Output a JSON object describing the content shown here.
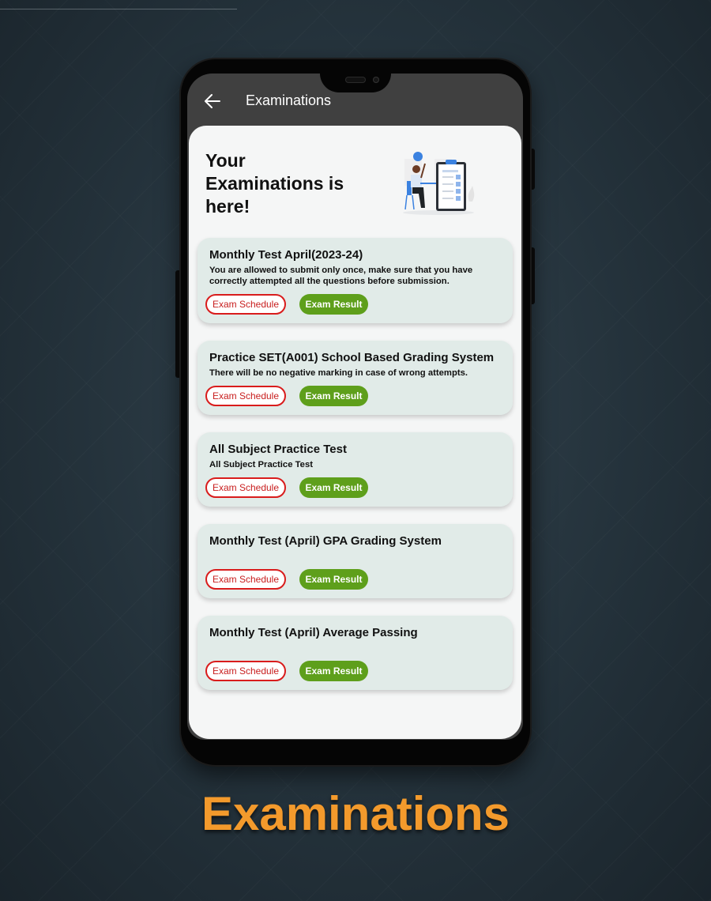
{
  "app_bar": {
    "title": "Examinations",
    "back_icon": "arrow-left-icon"
  },
  "hero": {
    "heading": "Your Examinations is here!",
    "illustration": "person-with-clipboard-checklist-illustration"
  },
  "exams": [
    {
      "title": "Monthly Test April(2023-24)",
      "description": "You are allowed to submit only once, make sure that you have correctly attempted all the questions before submission.",
      "schedule_label": "Exam Schedule",
      "result_label": "Exam Result"
    },
    {
      "title": "Practice SET(A001) School Based Grading System",
      "description": "There will be no negative marking in case of wrong attempts.",
      "schedule_label": "Exam Schedule",
      "result_label": "Exam Result"
    },
    {
      "title": "All Subject Practice Test",
      "description": "All Subject Practice Test",
      "schedule_label": "Exam Schedule",
      "result_label": "Exam Result"
    },
    {
      "title": "Monthly Test (April) GPA Grading System",
      "description": "",
      "schedule_label": "Exam Schedule",
      "result_label": "Exam Result"
    },
    {
      "title": "Monthly Test (April) Average Passing",
      "description": "",
      "schedule_label": "Exam Schedule",
      "result_label": "Exam Result"
    }
  ],
  "caption": "Examinations",
  "colors": {
    "app_bar": "#404040",
    "card_bg": "#e1ebe8",
    "schedule_border": "#d91c1c",
    "result_bg": "#5e9f1b",
    "caption": "#f39a2c"
  }
}
